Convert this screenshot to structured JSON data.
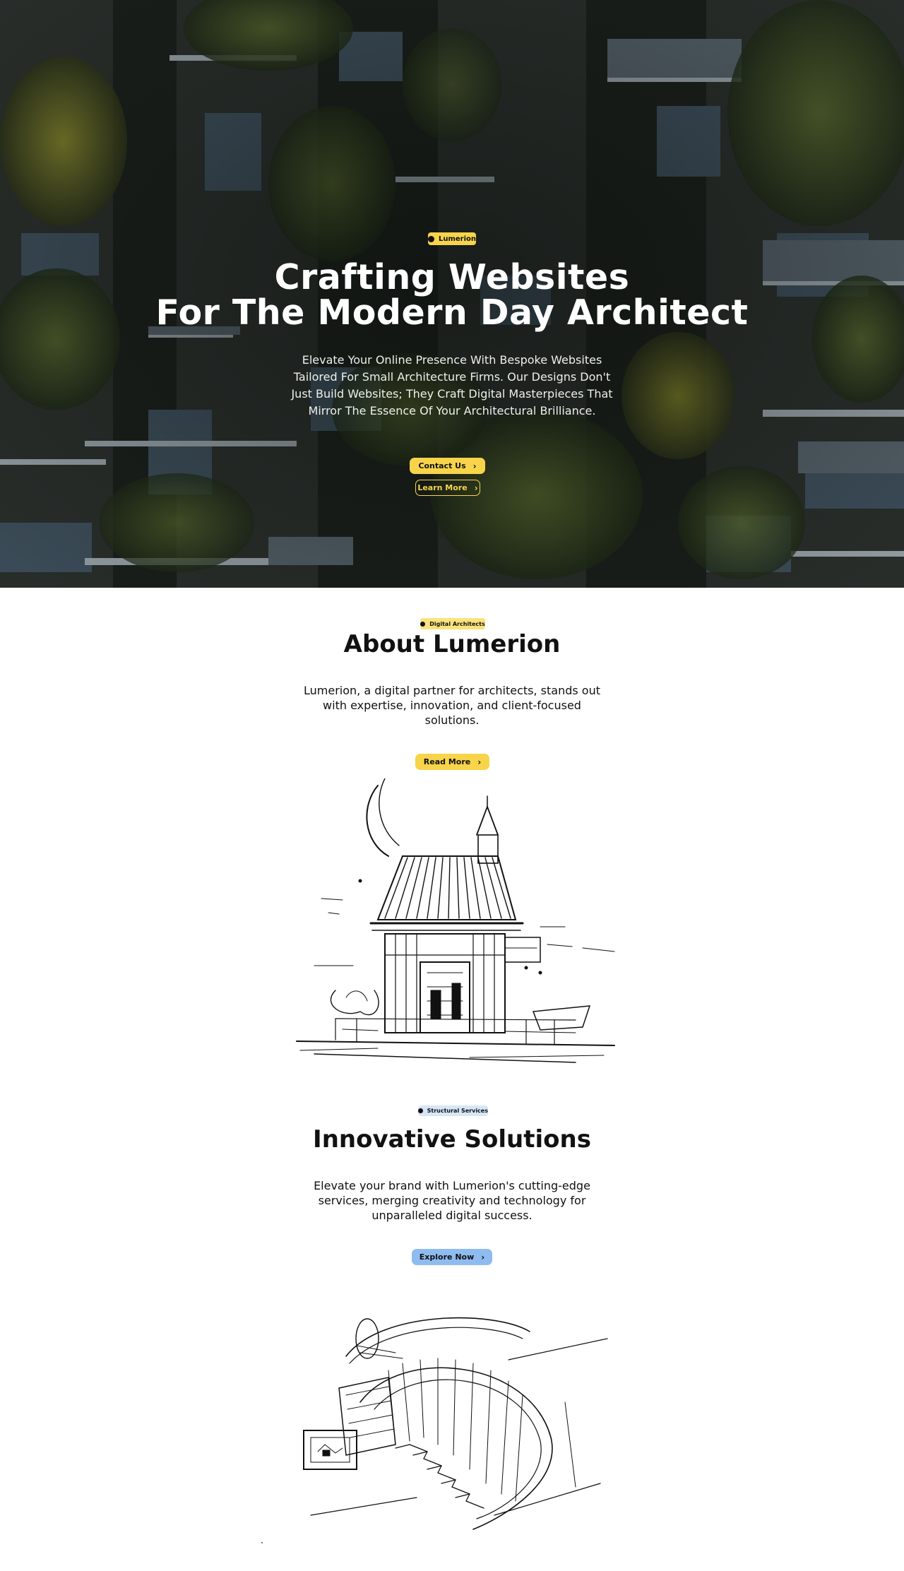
{
  "hero": {
    "badge_label": "Lumerion",
    "title_line1": "Crafting Websites",
    "title_line2": "For The Modern Day Architect",
    "subtitle_lines": [
      "Elevate Your Online Presence With Bespoke Websites",
      "Tailored For Small Architecture Firms. Our Designs Don't",
      "Just Build Websites; They Craft Digital Masterpieces That",
      "Mirror The Essence Of Your Architectural Brilliance."
    ],
    "contact_label": "Contact Us",
    "learn_label": "Learn More",
    "background_image": "vertical-forest-building-photo"
  },
  "about": {
    "badge_label": "Digital Architects",
    "title": "About Lumerion",
    "text_lines": [
      "Lumerion, a digital partner for architects, stands out",
      "with expertise, innovation, and client-focused",
      "solutions."
    ],
    "button_label": "Read More",
    "illustration": "pagoda-house-sketch"
  },
  "services": {
    "badge_label": "Structural Services",
    "title": "Innovative Solutions",
    "text_lines": [
      "Elevate your brand with Lumerion's cutting-edge",
      "services, merging creativity and technology for",
      "unparalleled digital success."
    ],
    "button_label": "Explore Now",
    "illustration": "spiral-staircase-sketch"
  },
  "colors": {
    "accent_yellow": "#f7d44a",
    "light_yellow": "#fbe37b",
    "accent_blue": "#8fbcf0",
    "light_blue": "#d7e6f7",
    "text_dark": "#111111",
    "hero_dark": "#101512"
  }
}
